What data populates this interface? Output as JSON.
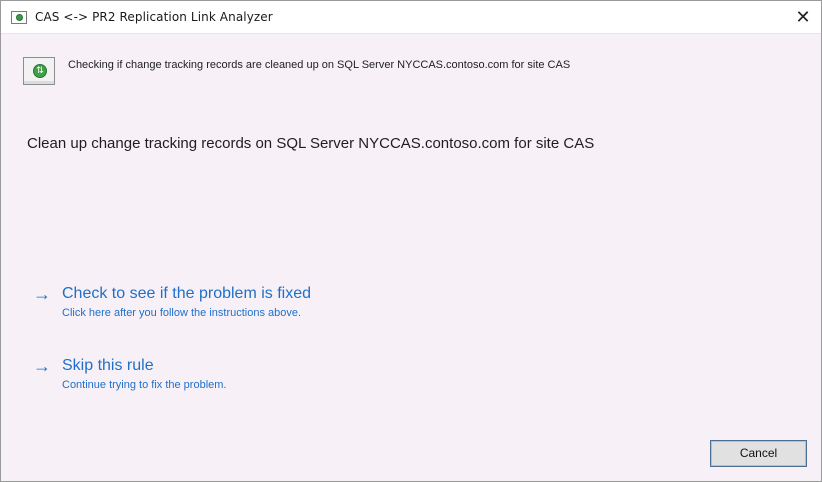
{
  "window": {
    "title": "CAS <-> PR2 Replication Link Analyzer",
    "close_glyph": "✕"
  },
  "header": {
    "icon": "replication-status-icon",
    "icon_glyph": "⇅",
    "status_text": "Checking if change tracking records are cleaned up on SQL Server NYCCAS.contoso.com for site CAS"
  },
  "main": {
    "instruction": "Clean up change tracking records on SQL Server NYCCAS.contoso.com for site CAS"
  },
  "links": {
    "arrow_glyph": "→",
    "check": {
      "label": "Check to see if the problem is fixed",
      "description": "Click here after you follow the instructions above."
    },
    "skip": {
      "label": "Skip this rule",
      "description": "Continue trying to fix the problem."
    }
  },
  "footer": {
    "cancel_label": "Cancel"
  },
  "colors": {
    "link": "#1f6fc9",
    "background": "#f7f1f7"
  }
}
